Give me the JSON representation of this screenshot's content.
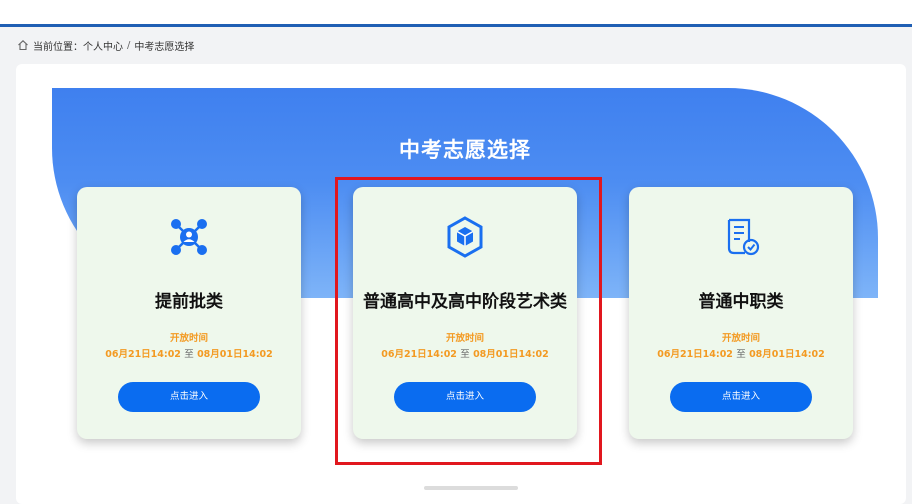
{
  "breadcrumb": {
    "prefix": "当前位置：",
    "items": [
      "个人中心",
      "中考志愿选择"
    ],
    "separator": "/",
    "home_icon": "home-icon"
  },
  "banner": {
    "title": "中考志愿选择"
  },
  "cards": [
    {
      "icon": "network-people-icon",
      "title": "提前批类",
      "open_label": "开放时间",
      "open_start": "06月21日14:02",
      "open_to": "至",
      "open_end": "08月01日14:02",
      "button": "点击进入"
    },
    {
      "icon": "cube-icon",
      "title": "普通高中及高中阶段艺术类",
      "open_label": "开放时间",
      "open_start": "06月21日14:02",
      "open_to": "至",
      "open_end": "08月01日14:02",
      "button": "点击进入"
    },
    {
      "icon": "certificate-icon",
      "title": "普通中职类",
      "open_label": "开放时间",
      "open_start": "06月21日14:02",
      "open_to": "至",
      "open_end": "08月01日14:02",
      "button": "点击进入"
    }
  ],
  "colors": {
    "accent_blue": "#0a6cf0",
    "banner_blue": "#3f80ef",
    "time_orange": "#f39a22",
    "highlight_red": "#e1171e",
    "card_bg": "#eef8ec"
  }
}
